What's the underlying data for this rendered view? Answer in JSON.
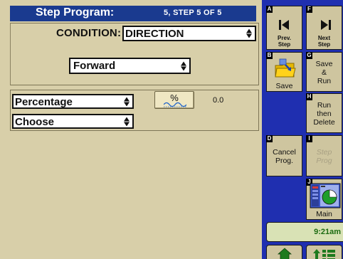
{
  "header": {
    "title": "Step Program:",
    "step_info": "5, STEP  5  OF  5"
  },
  "condition": {
    "label": "CONDITION:",
    "value": "DIRECTION",
    "direction_value": "Forward"
  },
  "params": {
    "unit_select": "Percentage",
    "choose_select": "Choose",
    "percent_button": "%",
    "value": "0.0"
  },
  "side_buttons": {
    "prev": {
      "key": "A",
      "label_line1": "Prev.",
      "label_line2": "Step"
    },
    "next": {
      "key": "F",
      "label_line1": "Next",
      "label_line2": "Step"
    },
    "save": {
      "key": "B",
      "label": "Save"
    },
    "save_run": {
      "key": "G",
      "line1": "Save",
      "line2": "&",
      "line3": "Run"
    },
    "run_delete": {
      "key": "H",
      "line1": "Run",
      "line2": "then",
      "line3": "Delete"
    },
    "cancel": {
      "key": "D",
      "line1": "Cancel",
      "line2": "Prog."
    },
    "step_prog": {
      "key": "I",
      "line1": "Step",
      "line2": "Prog",
      "enabled": false
    },
    "main": {
      "key": "J",
      "label": "Main"
    }
  },
  "clock": "9:21am",
  "colors": {
    "header_bg": "#1a3a8f",
    "panel_bg": "#d8cfa9",
    "sidebar_bg": "#1f2fb0",
    "button_bg": "#cec59f",
    "clock_text": "#1b6b10"
  }
}
